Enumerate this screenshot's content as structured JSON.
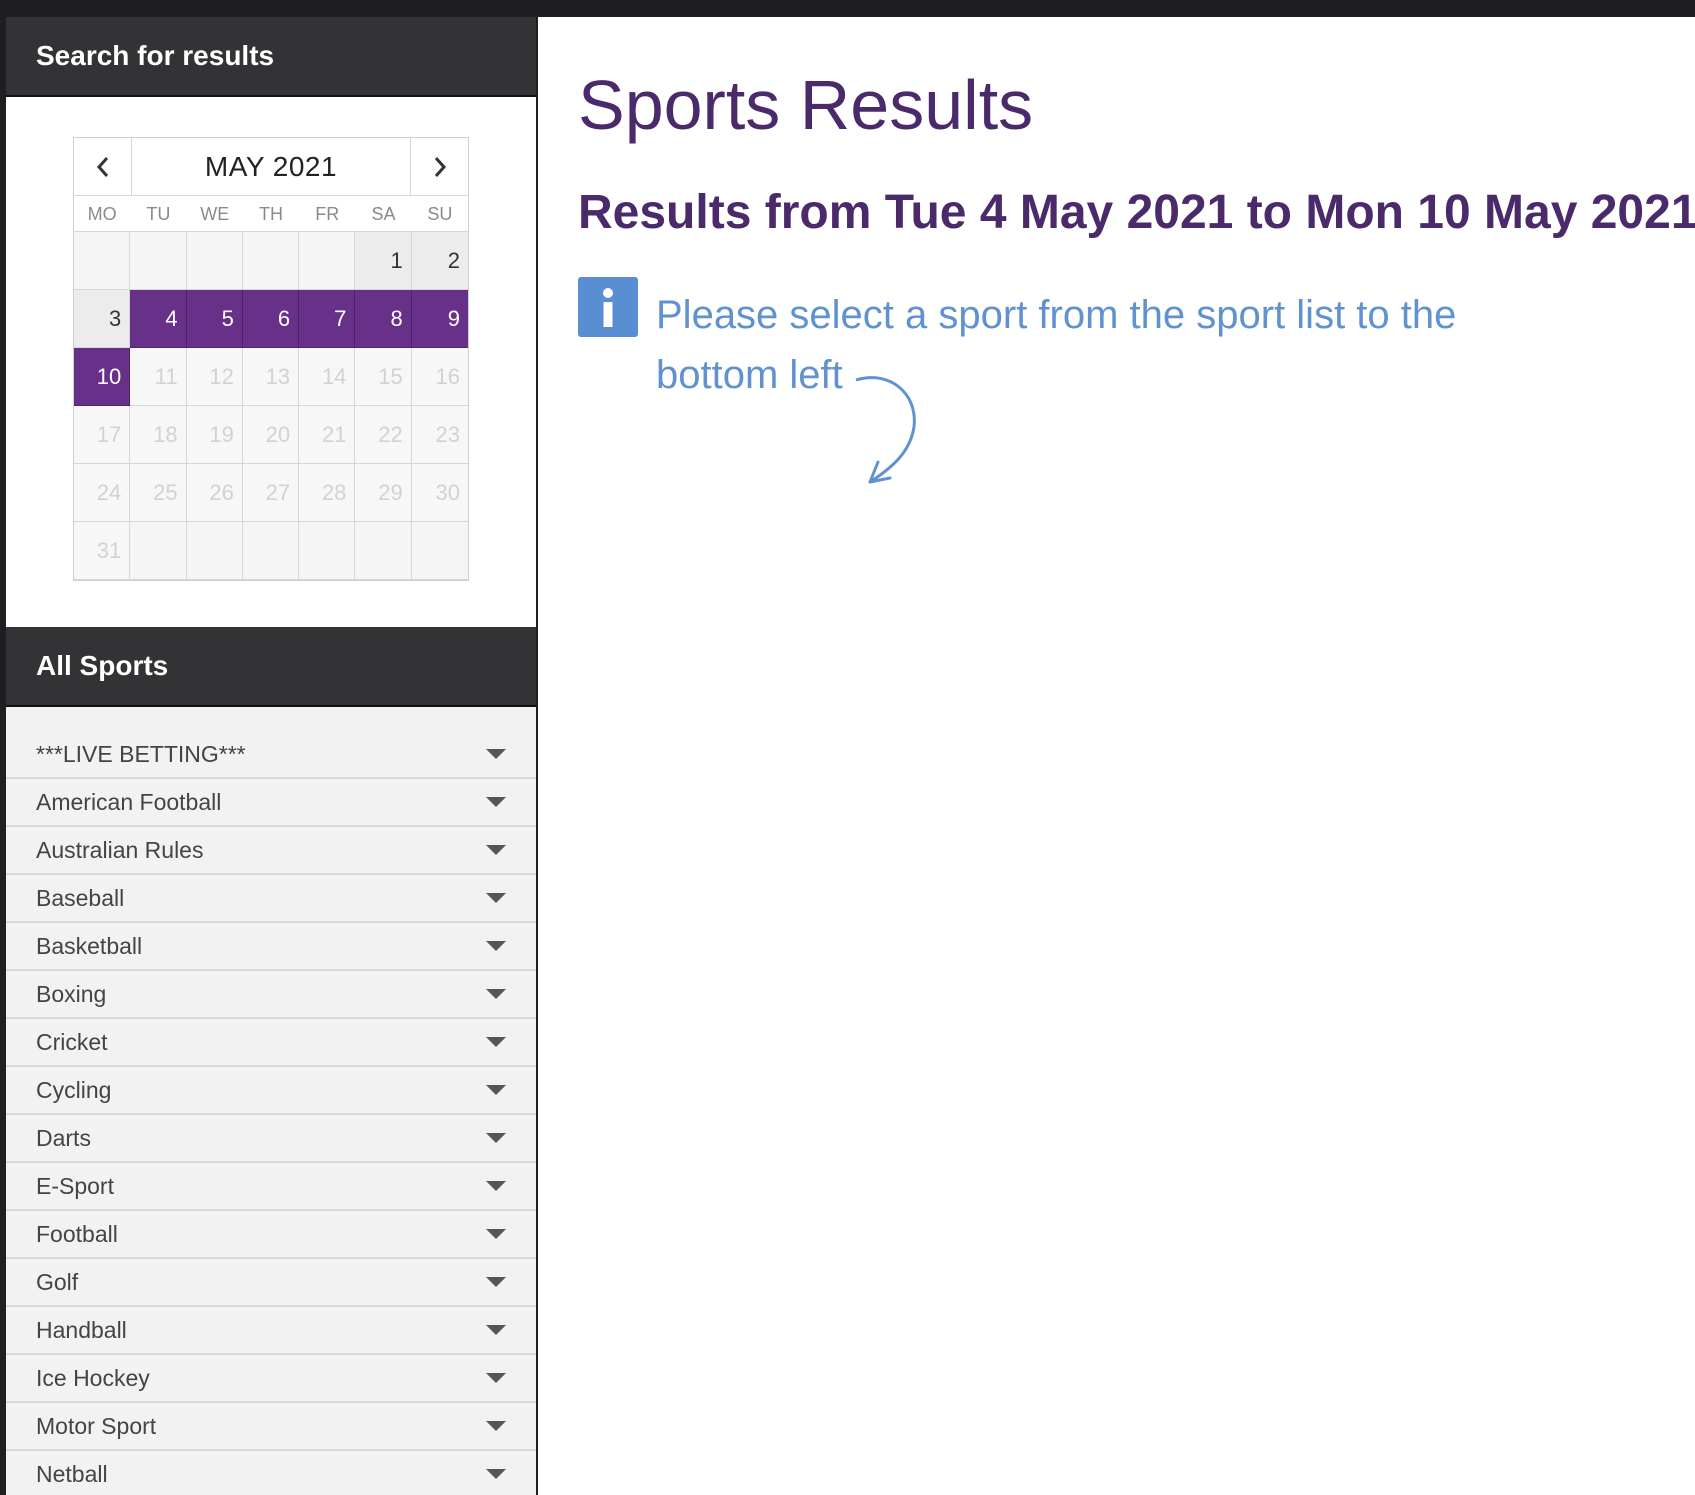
{
  "sidebar": {
    "search_title": "Search for results",
    "calendar": {
      "month_label": "MAY 2021",
      "prev_icon": "chevron-left-icon",
      "next_icon": "chevron-right-icon",
      "weekdays": [
        "MO",
        "TU",
        "WE",
        "TH",
        "FR",
        "SA",
        "SU"
      ],
      "cells": [
        {
          "label": "",
          "state": "empty"
        },
        {
          "label": "",
          "state": "empty"
        },
        {
          "label": "",
          "state": "empty"
        },
        {
          "label": "",
          "state": "empty"
        },
        {
          "label": "",
          "state": "empty"
        },
        {
          "label": "1",
          "state": "avail"
        },
        {
          "label": "2",
          "state": "avail"
        },
        {
          "label": "3",
          "state": "avail"
        },
        {
          "label": "4",
          "state": "sel"
        },
        {
          "label": "5",
          "state": "sel"
        },
        {
          "label": "6",
          "state": "sel"
        },
        {
          "label": "7",
          "state": "sel"
        },
        {
          "label": "8",
          "state": "sel"
        },
        {
          "label": "9",
          "state": "sel"
        },
        {
          "label": "10",
          "state": "sel"
        },
        {
          "label": "11",
          "state": "future"
        },
        {
          "label": "12",
          "state": "future"
        },
        {
          "label": "13",
          "state": "future"
        },
        {
          "label": "14",
          "state": "future"
        },
        {
          "label": "15",
          "state": "future"
        },
        {
          "label": "16",
          "state": "future"
        },
        {
          "label": "17",
          "state": "future"
        },
        {
          "label": "18",
          "state": "future"
        },
        {
          "label": "19",
          "state": "future"
        },
        {
          "label": "20",
          "state": "future"
        },
        {
          "label": "21",
          "state": "future"
        },
        {
          "label": "22",
          "state": "future"
        },
        {
          "label": "23",
          "state": "future"
        },
        {
          "label": "24",
          "state": "future"
        },
        {
          "label": "25",
          "state": "future"
        },
        {
          "label": "26",
          "state": "future"
        },
        {
          "label": "27",
          "state": "future"
        },
        {
          "label": "28",
          "state": "future"
        },
        {
          "label": "29",
          "state": "future"
        },
        {
          "label": "30",
          "state": "future"
        },
        {
          "label": "31",
          "state": "future"
        },
        {
          "label": "",
          "state": "empty"
        },
        {
          "label": "",
          "state": "empty"
        },
        {
          "label": "",
          "state": "empty"
        },
        {
          "label": "",
          "state": "empty"
        },
        {
          "label": "",
          "state": "empty"
        },
        {
          "label": "",
          "state": "empty"
        }
      ]
    },
    "sports_title": "All Sports",
    "sports": [
      "***LIVE BETTING***",
      "American Football",
      "Australian Rules",
      "Baseball",
      "Basketball",
      "Boxing",
      "Cricket",
      "Cycling",
      "Darts",
      "E-Sport",
      "Football",
      "Golf",
      "Handball",
      "Ice Hockey",
      "Motor Sport",
      "Netball"
    ]
  },
  "main": {
    "title": "Sports Results",
    "range": "Results from Tue 4 May 2021 to Mon 10 May 2021",
    "info_icon": "info-icon",
    "info_message": "Please select a sport from the sport list to the bottom left"
  },
  "colors": {
    "accent_purple": "#673189",
    "title_purple": "#4a2a6a",
    "info_blue": "#5a8ed3",
    "header_dark": "#333335"
  }
}
